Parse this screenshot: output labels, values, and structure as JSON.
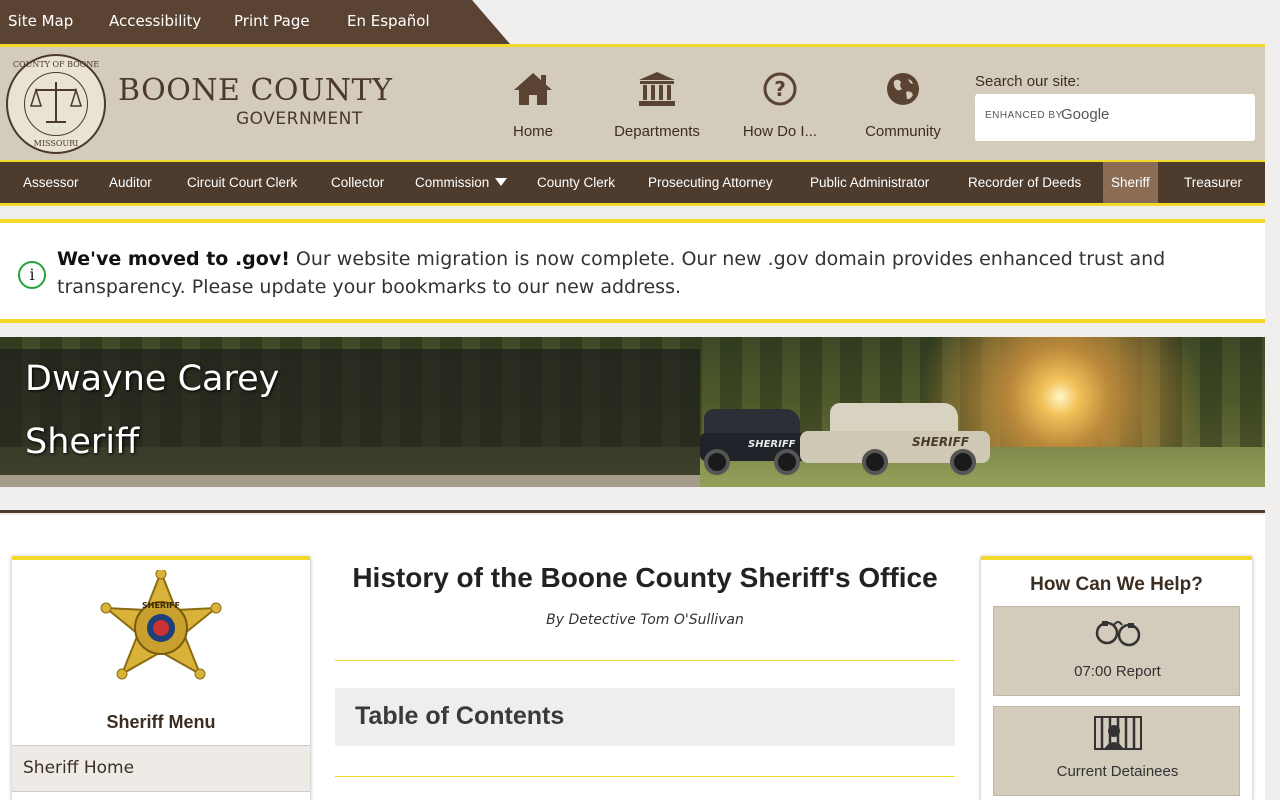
{
  "utility": {
    "site_map": "Site Map",
    "accessibility": "Accessibility",
    "print_page": "Print Page",
    "espanol": "En Español"
  },
  "brand": {
    "title": "BOONE COUNTY",
    "subtitle": "GOVERNMENT",
    "seal_top": "COUNTY OF BOONE",
    "seal_bottom": "MISSOURI"
  },
  "header_nav": [
    {
      "label": "Home",
      "icon": "home-icon"
    },
    {
      "label": "Departments",
      "icon": "building-icon"
    },
    {
      "label": "How Do I...",
      "icon": "question-icon"
    },
    {
      "label": "Community",
      "icon": "globe-icon"
    }
  ],
  "search": {
    "label": "Search our site:",
    "enhanced_by": "ENHANCED BY",
    "provider": "Google"
  },
  "dept_nav": [
    {
      "label": "Assessor"
    },
    {
      "label": "Auditor"
    },
    {
      "label": "Circuit Court Clerk"
    },
    {
      "label": "Collector"
    },
    {
      "label": "Commission"
    },
    {
      "label": "County Clerk"
    },
    {
      "label": "Prosecuting Attorney"
    },
    {
      "label": "Public Administrator"
    },
    {
      "label": "Recorder of Deeds"
    },
    {
      "label": "Sheriff",
      "active": true
    },
    {
      "label": "Treasurer"
    }
  ],
  "alert": {
    "bold": "We've moved to .gov!",
    "text": " Our website migration is now complete. Our new .gov domain provides enhanced trust and transparency. Please update your bookmarks to our new address."
  },
  "banner": {
    "name": "Dwayne Carey",
    "role": "Sheriff",
    "car_label_1": "SHERIFF",
    "car_label_2": "SHERIFF"
  },
  "left_sidebar": {
    "badge_text": "SHERIFF",
    "menu_title": "Sheriff Menu",
    "items": [
      {
        "label": "Sheriff Home"
      }
    ]
  },
  "article": {
    "title": "History of the Boone County Sheriff's Office",
    "byline": "By Detective Tom O'Sullivan",
    "toc_title": "Table of Contents"
  },
  "right_sidebar": {
    "title": "How Can We Help?",
    "tiles": [
      {
        "label": "07:00 Report",
        "icon": "handcuffs-icon"
      },
      {
        "label": "Current Detainees",
        "icon": "jail-icon"
      }
    ]
  },
  "colors": {
    "brown": "#4d3b2d",
    "tan": "#d3cbbb",
    "accent_yellow": "#f3d92a",
    "active_tab": "#8b6d55",
    "info_green": "#27a23a"
  }
}
